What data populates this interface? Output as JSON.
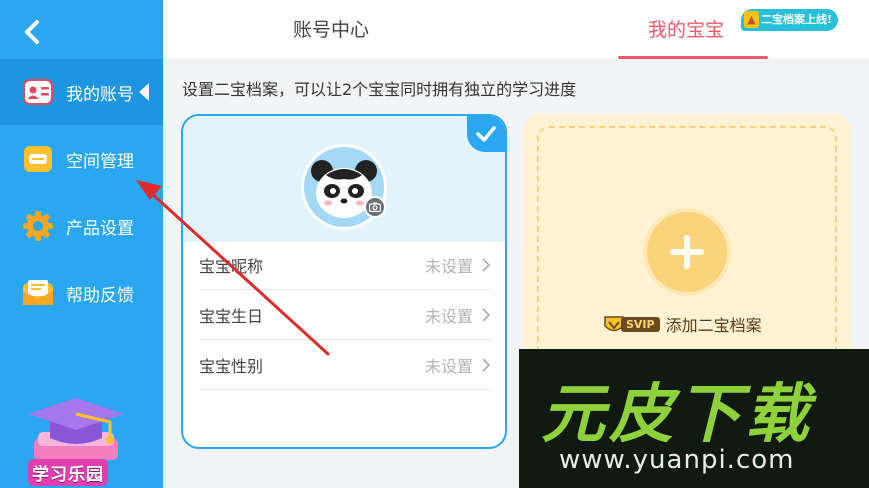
{
  "sidebar": {
    "items": [
      {
        "label": "我的账号",
        "icon": "id-card-icon"
      },
      {
        "label": "空间管理",
        "icon": "storage-box-icon"
      },
      {
        "label": "产品设置",
        "icon": "gear-icon"
      },
      {
        "label": "帮助反馈",
        "icon": "mail-icon"
      }
    ],
    "promo_label": "学习乐园"
  },
  "header": {
    "tabs": [
      {
        "label": "账号中心"
      },
      {
        "label": "我的宝宝"
      }
    ],
    "badge": "二宝档案上线!"
  },
  "hint": "设置二宝档案，可以让2个宝宝同时拥有独立的学习进度",
  "profile": {
    "rows": [
      {
        "label": "宝宝昵称",
        "value": "未设置"
      },
      {
        "label": "宝宝生日",
        "value": "未设置"
      },
      {
        "label": "宝宝性别",
        "value": "未设置"
      }
    ]
  },
  "add_card": {
    "svip": "SVIP",
    "label": "添加二宝档案"
  },
  "watermark": {
    "big": "元皮下载",
    "small": "www.yuanpi.com"
  },
  "colors": {
    "sidebar": "#2aa7f0",
    "accent": "#ee5a6c",
    "add_card": "#fdf2d4"
  }
}
